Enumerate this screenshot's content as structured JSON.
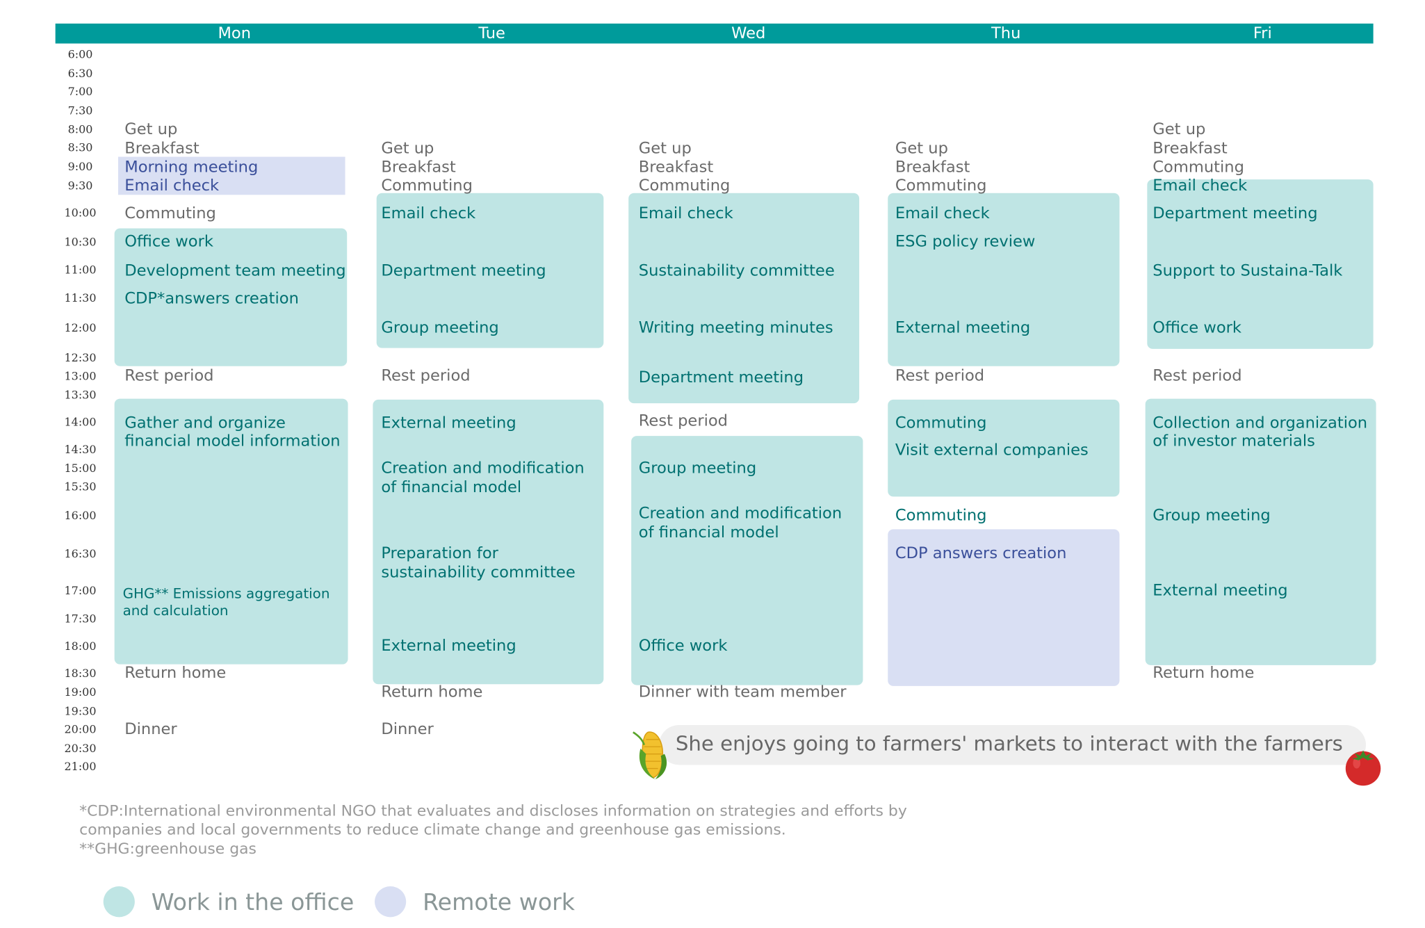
{
  "days": [
    "Mon",
    "Tue",
    "Wed",
    "Thu",
    "Fri"
  ],
  "times": [
    "6:00",
    "6:30",
    "7:00",
    "7:30",
    "8:00",
    "8:30",
    "9:00",
    "9:30",
    "10:00",
    "10:30",
    "11:00",
    "11:30",
    "12:00",
    "12:30",
    "13:00",
    "13:30",
    "14:00",
    "14:30",
    "15:00",
    "15:30",
    "16:00",
    "16:30",
    "17:00",
    "17:30",
    "18:00",
    "18:30",
    "19:00",
    "19:30",
    "20:00",
    "20:30",
    "21:00"
  ],
  "colors": {
    "header": "#009b9b",
    "office_fill": "#bfe5e4",
    "remote_fill": "#d9dff3",
    "office_text": "#007070",
    "remote_text": "#3a4f9a",
    "personal_text": "#6a6a6a"
  },
  "schedule": {
    "mon": {
      "get_up": "Get up",
      "breakfast": "Breakfast",
      "morning_meeting": "Morning meeting",
      "email_check": "Email check",
      "commuting": "Commuting",
      "office_work": "Office work",
      "dev_team_meeting": "Development team meeting",
      "cdp_answers": "CDP*answers creation",
      "rest_period": "Rest period",
      "gather_1": "Gather and organize",
      "gather_2": "financial model information",
      "ghg_1": "GHG** Emissions aggregation",
      "ghg_2": "and calculation",
      "return_home": "Return home",
      "dinner": "Dinner"
    },
    "tue": {
      "get_up": "Get up",
      "breakfast": "Breakfast",
      "commuting": "Commuting",
      "email_check": "Email check",
      "department_meeting": "Department meeting",
      "group_meeting": "Group meeting",
      "rest_period": "Rest period",
      "external_meeting_1": "External meeting",
      "creation_1": "Creation and modification",
      "creation_2": "of financial model",
      "prep_1": "Preparation for",
      "prep_2": "sustainability committee",
      "external_meeting_2": "External meeting",
      "return_home": "Return home",
      "dinner": "Dinner"
    },
    "wed": {
      "get_up": "Get up",
      "breakfast": "Breakfast",
      "commuting": "Commuting",
      "email_check": "Email check",
      "sustainability_committee": "Sustainability committee",
      "writing_minutes": "Writing meeting minutes",
      "department_meeting": "Department meeting",
      "rest_period": "Rest period",
      "group_meeting": "Group meeting",
      "creation_1": "Creation and modification",
      "creation_2": "of financial model",
      "office_work": "Office work",
      "dinner_team": "Dinner with team member"
    },
    "thu": {
      "get_up": "Get up",
      "breakfast": "Breakfast",
      "commuting": "Commuting",
      "email_check": "Email check",
      "esg_review": "ESG policy review",
      "external_meeting": "External meeting",
      "rest_period": "Rest period",
      "commuting_2": "Commuting",
      "visit_external": "Visit external companies",
      "commuting_3": "Commuting",
      "cdp_answers": "CDP answers creation"
    },
    "fri": {
      "get_up": "Get up",
      "breakfast": "Breakfast",
      "commuting": "Commuting",
      "email_check": "Email check",
      "department_meeting": "Department meeting",
      "support": "Support to Sustaina-Talk",
      "office_work": "Office work",
      "rest_period": "Rest period",
      "collection_1": "Collection and organization",
      "collection_2": "of investor materials",
      "group_meeting": "Group meeting",
      "external_meeting": "External meeting",
      "return_home": "Return home"
    }
  },
  "bubble": {
    "text": "She enjoys going to farmers' markets to interact with the farmers",
    "left_icon": "corn-icon",
    "right_icon": "tomato-icon"
  },
  "notes": {
    "cdp_line1": "*CDP:International environmental NGO that evaluates and discloses information on strategies and efforts by",
    "cdp_line2": "companies and local governments to reduce climate change and greenhouse gas emissions.",
    "ghg": "**GHG:greenhouse gas"
  },
  "legend": {
    "office": "Work in the office",
    "remote": "Remote work"
  }
}
